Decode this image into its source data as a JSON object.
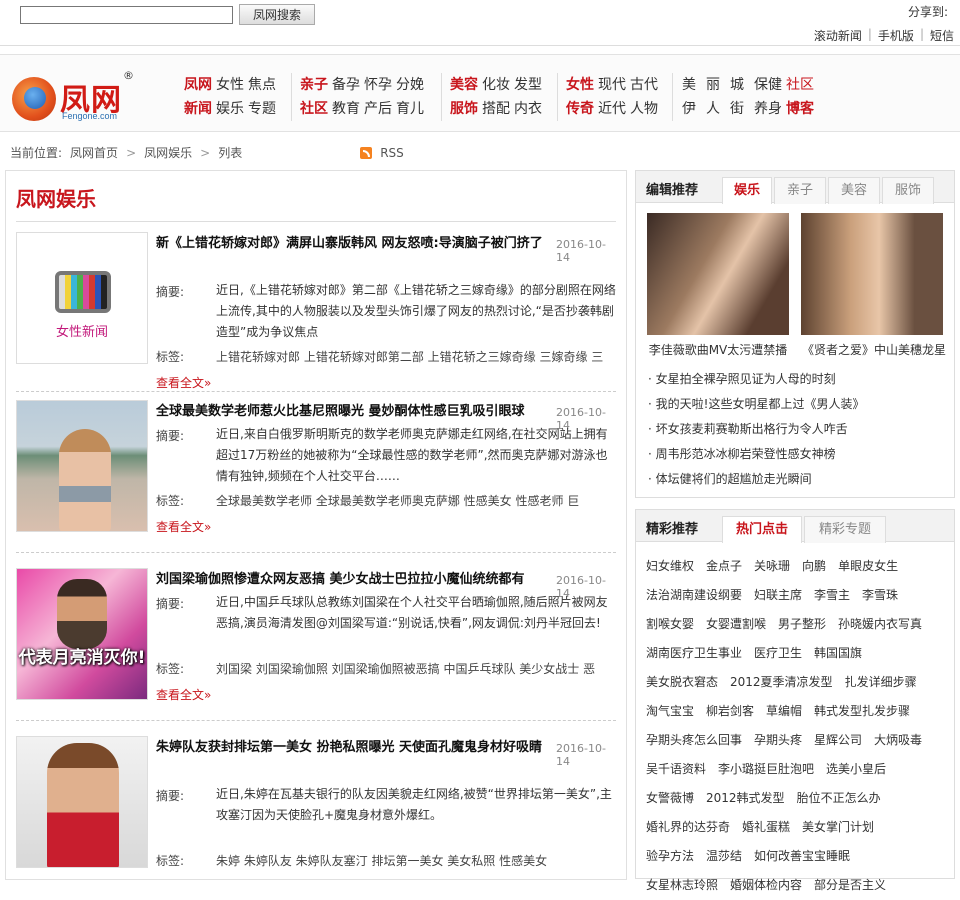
{
  "top": {
    "search_value": "",
    "search_button": "凤网搜索",
    "share_label": "分享到:",
    "links": [
      "滚动新闻",
      "手机版",
      "短信"
    ]
  },
  "logo": {
    "name": "凤网",
    "reg": "®",
    "domain": "Fengone.com"
  },
  "nav": {
    "groups": [
      {
        "rows": [
          [
            "凤网",
            "女性",
            "焦点"
          ],
          [
            "新闻",
            "娱乐",
            "专题"
          ]
        ]
      },
      {
        "rows": [
          [
            "亲子",
            "备孕",
            "怀孕",
            "分娩"
          ],
          [
            "社区",
            "教育",
            "产后",
            "育儿"
          ]
        ]
      },
      {
        "rows": [
          [
            "美容",
            "化妆",
            "发型"
          ],
          [
            "服饰",
            "搭配",
            "内衣"
          ]
        ]
      },
      {
        "rows": [
          [
            "女性",
            "现代",
            "古代"
          ],
          [
            "传奇",
            "近代",
            "人物"
          ]
        ]
      },
      {
        "rows": [
          [
            "美",
            "丽",
            "城",
            "保健",
            "社区"
          ],
          [
            "伊",
            "人",
            "街",
            "养身",
            "博客"
          ]
        ]
      }
    ]
  },
  "crumb": {
    "label": "当前位置:",
    "items": [
      "凤网首页",
      "凤网娱乐",
      "列表"
    ],
    "rss": "RSS"
  },
  "main": {
    "title": "凤网娱乐",
    "abstract_label": "摘要:",
    "tags_label": "标签:",
    "more_label": "查看全文»",
    "articles": [
      {
        "title": "新《上错花轿嫁对郎》满屏山寨版韩风 网友怒喷:导演脑子被门挤了",
        "date": "2016-10-14",
        "abstract": "近日,《上错花轿嫁对郎》第二部《上错花轿之三嫁奇缘》的部分剧照在网络上流传,其中的人物服装以及发型头饰引爆了网友的热烈讨论,“是否抄袭韩剧造型”成为争议焦点",
        "tags": "上错花轿嫁对郎 上错花轿嫁对郎第二部 上错花轿之三嫁奇缘 三嫁奇缘 三",
        "thumb_text": "女性新闻"
      },
      {
        "title": "全球最美数学老师惹火比基尼照曝光 曼妙酮体性感巨乳吸引眼球",
        "date": "2016-10-14",
        "abstract": "近日,来自白俄罗斯明斯克的数学老师奥克萨娜走红网络,在社交网站上拥有超过17万粉丝的她被称为“全球最性感的数学老师”,然而奥克萨娜对游泳也情有独钟,频频在个人社交平台……",
        "tags": "全球最美数学老师 全球最美数学老师奥克萨娜 性感美女 性感老师 巨"
      },
      {
        "title": "刘国梁瑜伽照惨遭众网友恶搞 美少女战士巴拉拉小魔仙统统都有",
        "date": "2016-10-14",
        "abstract": "近日,中国乒乓球队总教练刘国梁在个人社交平台晒瑜伽照,随后照片被网友恶搞,演员海清发图@刘国梁写道:“别说话,快看”,网友调侃:刘丹半冠回去!",
        "tags": "刘国梁 刘国梁瑜伽照 刘国梁瑜伽照被恶搞 中国乒乓球队 美少女战士 恶",
        "thumb_text": "代表月亮消灭你!"
      },
      {
        "title": "朱婷队友获封排坛第一美女 扮艳私照曝光 天使面孔魔鬼身材好吸睛",
        "date": "2016-10-14",
        "abstract": "近日,朱婷在瓦基夫银行的队友因美貌走红网络,被赞“世界排坛第一美女”,主攻塞汀因为天使脸孔+魔鬼身材意外爆红。",
        "tags": "朱婷 朱婷队友 朱婷队友塞汀 排坛第一美女 美女私照 性感美女"
      }
    ]
  },
  "editor": {
    "heading": "编辑推荐",
    "tabs": [
      "娱乐",
      "亲子",
      "美容",
      "服饰"
    ],
    "pics": [
      "李佳薇歌曲MV太污遭禁播",
      "《贤者之爱》中山美穗龙星"
    ],
    "list": [
      "· 女星拍全裸孕照见证为人母的时刻",
      "· 我的天啦!这些女明星都上过《男人装》",
      "· 坏女孩麦莉赛勒斯出格行为令人咋舌",
      "· 周韦彤范冰冰柳岩荣登性感女神榜",
      "· 体坛健将们的超尴尬走光瞬间"
    ]
  },
  "hot": {
    "heading": "精彩推荐",
    "tabs": [
      "热门点击",
      "精彩专题"
    ],
    "rows": [
      [
        "妇女维权",
        "金点子",
        "关咏珊",
        "向鹏",
        "单眼皮女生"
      ],
      [
        "法治湖南建设纲要",
        "妇联主席",
        "李雪主",
        "李雪珠"
      ],
      [
        "割喉女婴",
        "女婴遭割喉",
        "男子整形",
        "孙晓媛内衣写真"
      ],
      [
        "湖南医疗卫生事业",
        "医疗卫生",
        "韩国国旗"
      ],
      [
        "美女脱衣窘态",
        "2012夏季清凉发型",
        "扎发详细步骤"
      ],
      [
        "淘气宝宝",
        "柳岩剑客",
        "草编帽",
        "韩式发型扎发步骤"
      ],
      [
        "孕期头疼怎么回事",
        "孕期头疼",
        "星辉公司",
        "大炳吸毒"
      ],
      [
        "吴千语资料",
        "李小璐挺巨肚泡吧",
        "选美小皇后"
      ],
      [
        "女警薇博",
        "2012韩式发型",
        "胎位不正怎么办"
      ],
      [
        "婚礼界的达芬奇",
        "婚礼蛋糕",
        "美女掌门计划"
      ],
      [
        "验孕方法",
        "温莎结",
        "如何改善宝宝睡眠"
      ],
      [
        "女星林志玲照",
        "婚姻体检内容",
        "部分是否主义"
      ]
    ]
  }
}
